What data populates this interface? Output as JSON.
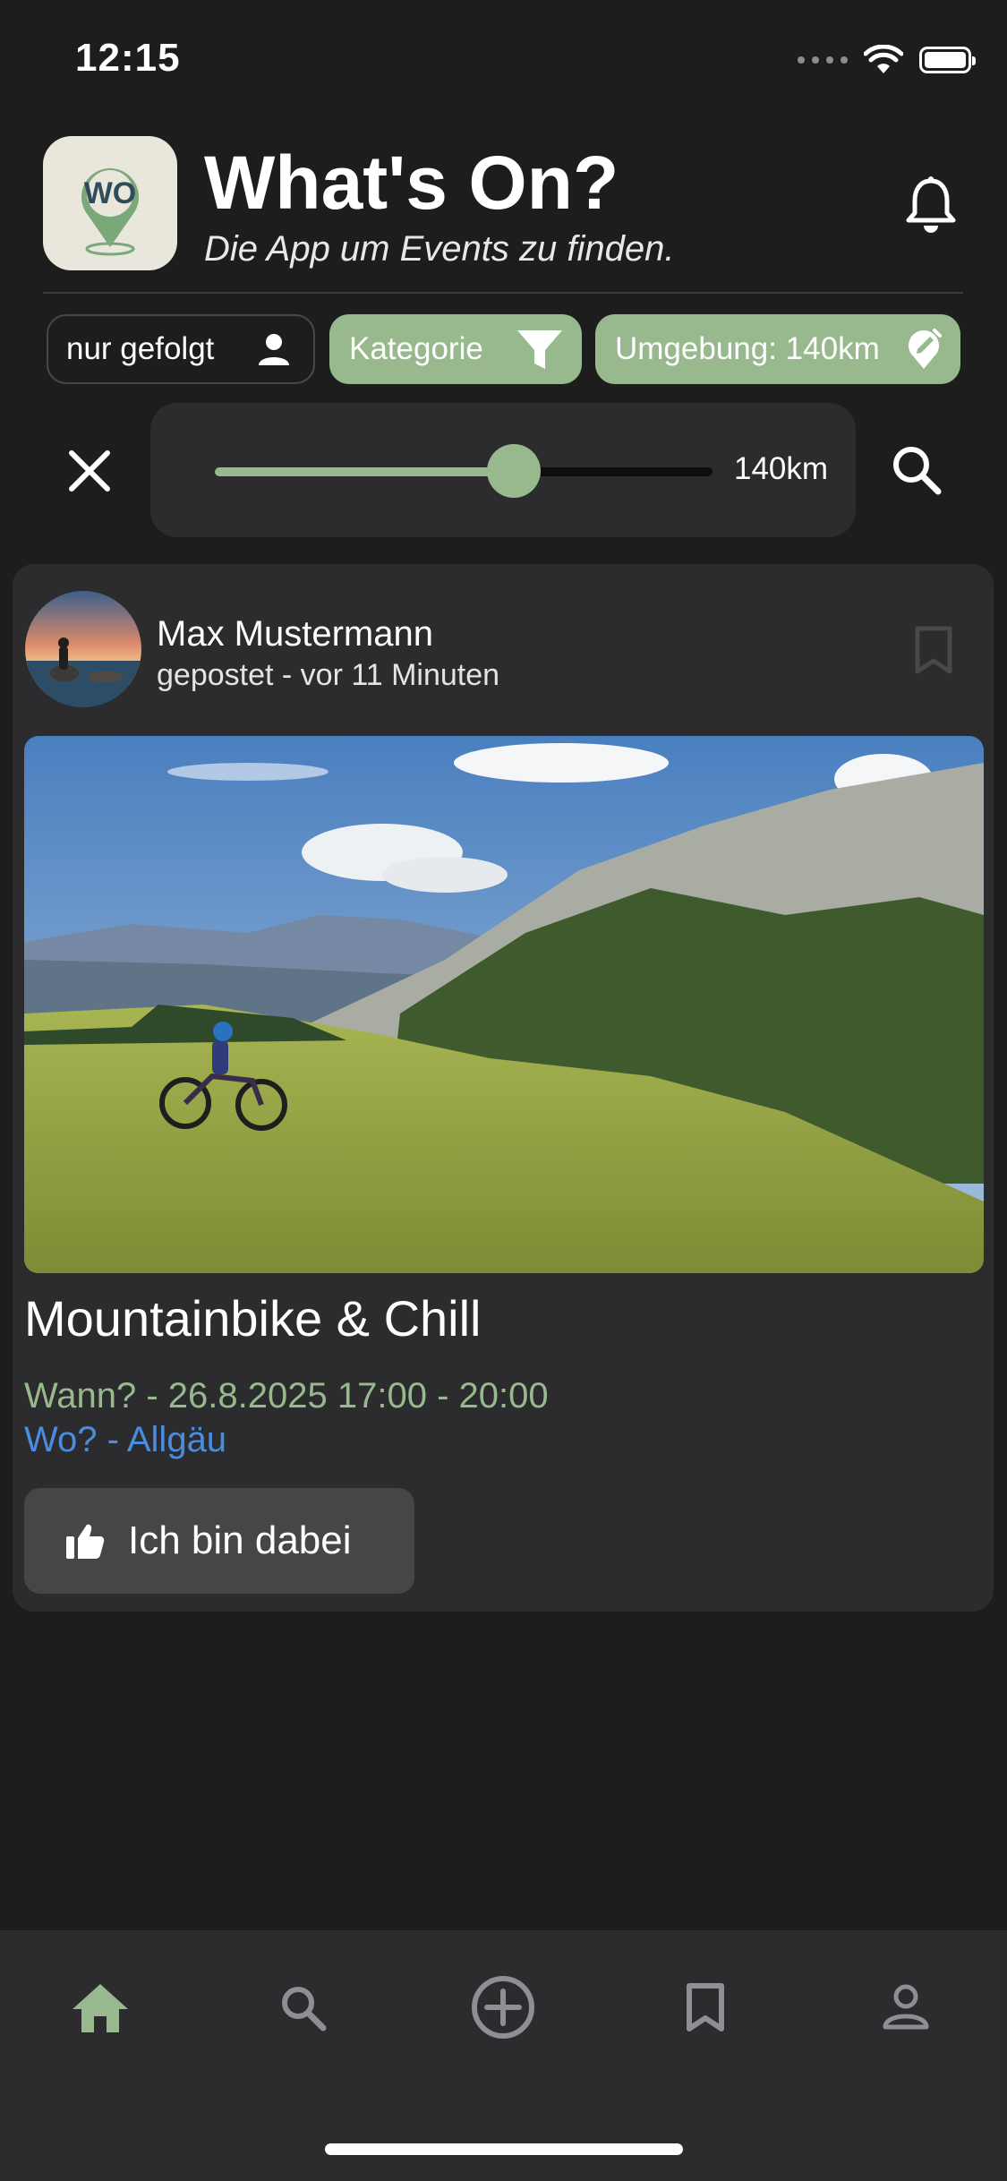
{
  "status_bar": {
    "time": "12:15",
    "icons": [
      "signal-icon",
      "wifi-icon",
      "battery-icon"
    ]
  },
  "header": {
    "logo_text": "WO",
    "title": "What's On?",
    "subtitle": "Die App um Events zu finden.",
    "notification_icon": "bell-icon"
  },
  "filters": {
    "followed": {
      "label": "nur gefolgt",
      "icon": "person-icon",
      "active": false
    },
    "category": {
      "label": "Kategorie",
      "icon": "filter-icon",
      "active": true
    },
    "area": {
      "label": "Umgebung: 140km",
      "icon": "location-edit-icon",
      "active": true
    }
  },
  "radius_slider": {
    "value_label": "140km",
    "fraction": 0.6
  },
  "post": {
    "author": "Max Mustermann",
    "posted": "gepostet - vor 11 Minuten",
    "title": "Mountainbike & Chill",
    "when": "Wann? - 26.8.2025 17:00 - 20:00",
    "where": "Wo? - Allgäu",
    "join_label": "Ich bin dabei",
    "bookmarked": false
  },
  "bottom_nav": {
    "items": [
      {
        "name": "home",
        "icon": "home-icon",
        "active": true
      },
      {
        "name": "search",
        "icon": "search-icon",
        "active": false
      },
      {
        "name": "create",
        "icon": "add-circle-icon",
        "active": false
      },
      {
        "name": "saved",
        "icon": "bookmark-icon",
        "active": false
      },
      {
        "name": "profile",
        "icon": "profile-icon",
        "active": false
      }
    ]
  },
  "colors": {
    "background": "#1d1d1e",
    "surface": "#2c2c2e",
    "accent_green": "#97b98d",
    "link_blue": "#4a8cde"
  }
}
